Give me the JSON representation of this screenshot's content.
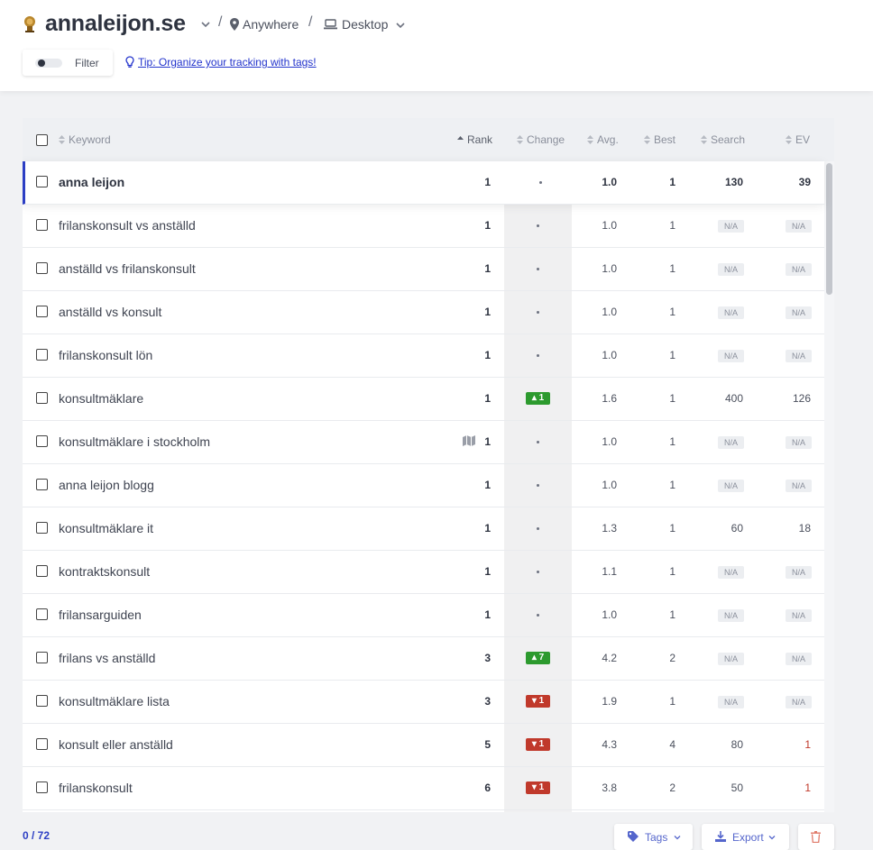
{
  "header": {
    "site": "annaleijon.se",
    "location": "Anywhere",
    "device": "Desktop",
    "separator": "/",
    "filter_label": "Filter",
    "tip": "Tip: Organize your tracking with tags!"
  },
  "columns": {
    "keyword": "Keyword",
    "rank": "Rank",
    "change": "Change",
    "avg": "Avg.",
    "best": "Best",
    "search": "Search",
    "ev": "EV"
  },
  "rows": [
    {
      "keyword": "anna leijon",
      "rank": "1",
      "change": null,
      "avg": "1.0",
      "best": "1",
      "search": "130",
      "ev": "39",
      "active": true
    },
    {
      "keyword": "frilanskonsult vs anställd",
      "rank": "1",
      "change": null,
      "avg": "1.0",
      "best": "1",
      "search": "N/A",
      "ev": "N/A"
    },
    {
      "keyword": "anställd vs frilanskonsult",
      "rank": "1",
      "change": null,
      "avg": "1.0",
      "best": "1",
      "search": "N/A",
      "ev": "N/A"
    },
    {
      "keyword": "anställd vs konsult",
      "rank": "1",
      "change": null,
      "avg": "1.0",
      "best": "1",
      "search": "N/A",
      "ev": "N/A"
    },
    {
      "keyword": "frilanskonsult lön",
      "rank": "1",
      "change": null,
      "avg": "1.0",
      "best": "1",
      "search": "N/A",
      "ev": "N/A"
    },
    {
      "keyword": "konsultmäklare",
      "rank": "1",
      "change": {
        "dir": "up",
        "value": "1"
      },
      "avg": "1.6",
      "best": "1",
      "search": "400",
      "ev": "126"
    },
    {
      "keyword": "konsultmäklare i stockholm",
      "rank": "1",
      "change": null,
      "avg": "1.0",
      "best": "1",
      "search": "N/A",
      "ev": "N/A",
      "serp_icon": "map-icon"
    },
    {
      "keyword": "anna leijon blogg",
      "rank": "1",
      "change": null,
      "avg": "1.0",
      "best": "1",
      "search": "N/A",
      "ev": "N/A"
    },
    {
      "keyword": "konsultmäklare it",
      "rank": "1",
      "change": null,
      "avg": "1.3",
      "best": "1",
      "search": "60",
      "ev": "18"
    },
    {
      "keyword": "kontraktskonsult",
      "rank": "1",
      "change": null,
      "avg": "1.1",
      "best": "1",
      "search": "N/A",
      "ev": "N/A"
    },
    {
      "keyword": "frilansarguiden",
      "rank": "1",
      "change": null,
      "avg": "1.0",
      "best": "1",
      "search": "N/A",
      "ev": "N/A"
    },
    {
      "keyword": "frilans vs anställd",
      "rank": "3",
      "change": {
        "dir": "up",
        "value": "7"
      },
      "avg": "4.2",
      "best": "2",
      "search": "N/A",
      "ev": "N/A"
    },
    {
      "keyword": "konsultmäklare lista",
      "rank": "3",
      "change": {
        "dir": "down",
        "value": "1"
      },
      "avg": "1.9",
      "best": "1",
      "search": "N/A",
      "ev": "N/A"
    },
    {
      "keyword": "konsult eller anställd",
      "rank": "5",
      "change": {
        "dir": "down",
        "value": "1"
      },
      "avg": "4.3",
      "best": "4",
      "search": "80",
      "ev": "1",
      "ev_red": true
    },
    {
      "keyword": "frilanskonsult",
      "rank": "6",
      "change": {
        "dir": "down",
        "value": "1"
      },
      "avg": "3.8",
      "best": "2",
      "search": "50",
      "ev": "1",
      "ev_red": true
    }
  ],
  "footer": {
    "count": "0 / 72",
    "tags_label": "Tags",
    "export_label": "Export"
  },
  "colors": {
    "accent": "#2c3ec4",
    "up": "#2c9a2e",
    "down": "#c0392b"
  }
}
